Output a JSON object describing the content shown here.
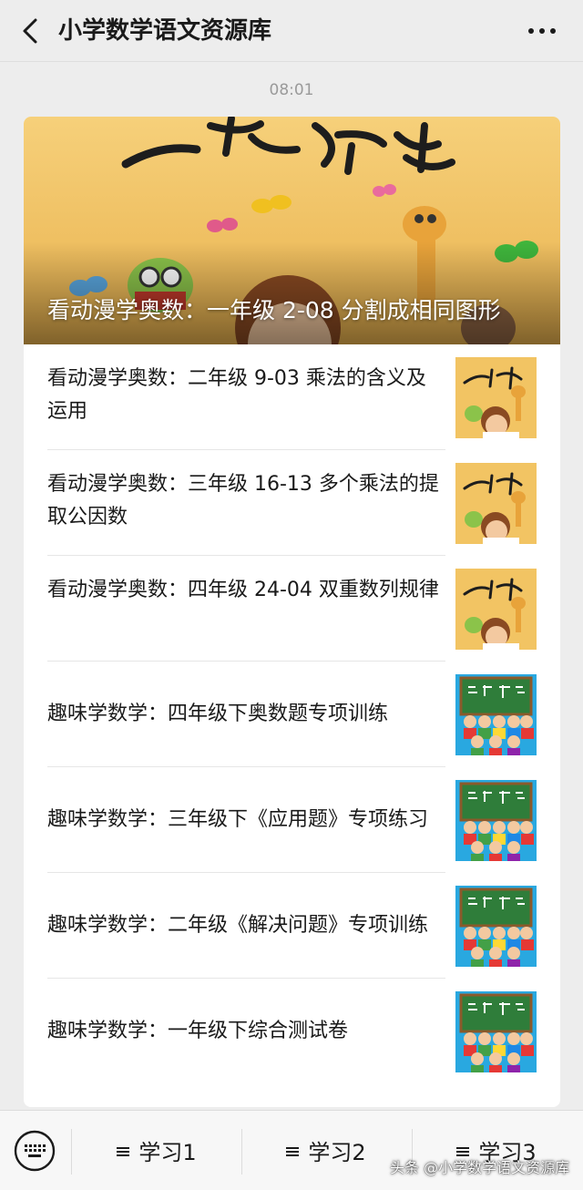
{
  "header": {
    "title": "小学数学语文资源库",
    "back_icon": "back-arrow-icon",
    "more_icon": "more-dots-icon"
  },
  "message_time": "08:01",
  "hero": {
    "title": "看动漫学奥数：一年级 2-08 分割成相同图形",
    "image_text": "一起学奥数"
  },
  "articles": [
    {
      "title": "看动漫学奥数：二年级 9-03 乘法的含义及运用",
      "thumb": "aoshu",
      "thumb_text": "一起学奥数"
    },
    {
      "title": "看动漫学奥数：三年级 16-13 多个乘法的提取公因数",
      "thumb": "aoshu",
      "thumb_text": "一起学奥数"
    },
    {
      "title": "看动漫学奥数：四年级 24-04 双重数列规律",
      "thumb": "aoshu",
      "thumb_text": "一起学奥数"
    },
    {
      "title": "趣味学数学：四年级下奥数题专项训练",
      "thumb": "quwei",
      "thumb_text": "趣味数学"
    },
    {
      "title": "趣味学数学：三年级下《应用题》专项练习",
      "thumb": "quwei",
      "thumb_text": "趣味数学"
    },
    {
      "title": "趣味学数学：二年级《解决问题》专项训练",
      "thumb": "quwei",
      "thumb_text": "趣味数学"
    },
    {
      "title": "趣味学数学：一年级下综合测试卷",
      "thumb": "quwei",
      "thumb_text": "趣味数学"
    }
  ],
  "bottom_menu": {
    "keyboard_icon": "keyboard-icon",
    "items": [
      "学习1",
      "学习2",
      "学习3"
    ]
  },
  "watermark": "头条 @小学数学语文资源库",
  "colors": {
    "background": "#ededed",
    "card": "#ffffff",
    "hero_bg": "#f2c463",
    "board_green": "#2f7d3a"
  }
}
